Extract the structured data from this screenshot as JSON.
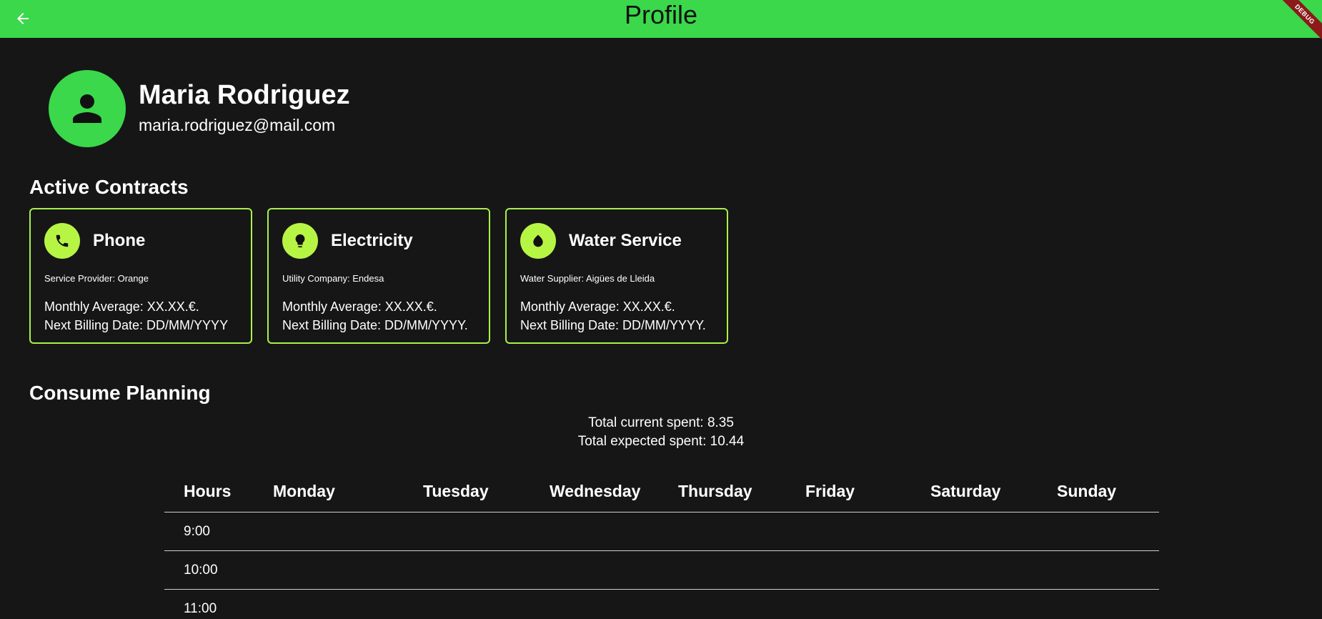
{
  "appbar": {
    "title": "Profile",
    "debug_label": "DEBUG",
    "color": "#3ad84a"
  },
  "user": {
    "name": "Maria Rodriguez",
    "email": "maria.rodriguez@mail.com"
  },
  "contracts": {
    "title": "Active Contracts",
    "items": [
      {
        "icon": "phone-icon",
        "title": "Phone",
        "provider": "Service Provider: Orange",
        "monthly": "Monthly Average: XX.XX.€.",
        "billing": "Next Billing Date: DD/MM/YYYY"
      },
      {
        "icon": "lightbulb-icon",
        "title": "Electricity",
        "provider": "Utility Company: Endesa",
        "monthly": "Monthly Average: XX.XX.€.",
        "billing": "Next Billing Date: DD/MM/YYYY."
      },
      {
        "icon": "water-drop-icon",
        "title": "Water Service",
        "provider": "Water Supplier: Aigües de Lleida",
        "monthly": "Monthly Average: XX.XX.€.",
        "billing": "Next Billing Date: DD/MM/YYYY."
      }
    ]
  },
  "planning": {
    "title": "Consume Planning",
    "current_spent": "Total current spent: 8.35",
    "expected_spent": "Total expected spent: 10.44",
    "columns": [
      "Hours",
      "Monday",
      "Tuesday",
      "Wednesday",
      "Thursday",
      "Friday",
      "Saturday",
      "Sunday"
    ],
    "hours": [
      "9:00",
      "10:00",
      "11:00"
    ]
  },
  "colors": {
    "accent_green": "#3ad84a",
    "card_border": "#a8f04a",
    "card_icon_bg": "#b7f544",
    "background": "#161616"
  }
}
